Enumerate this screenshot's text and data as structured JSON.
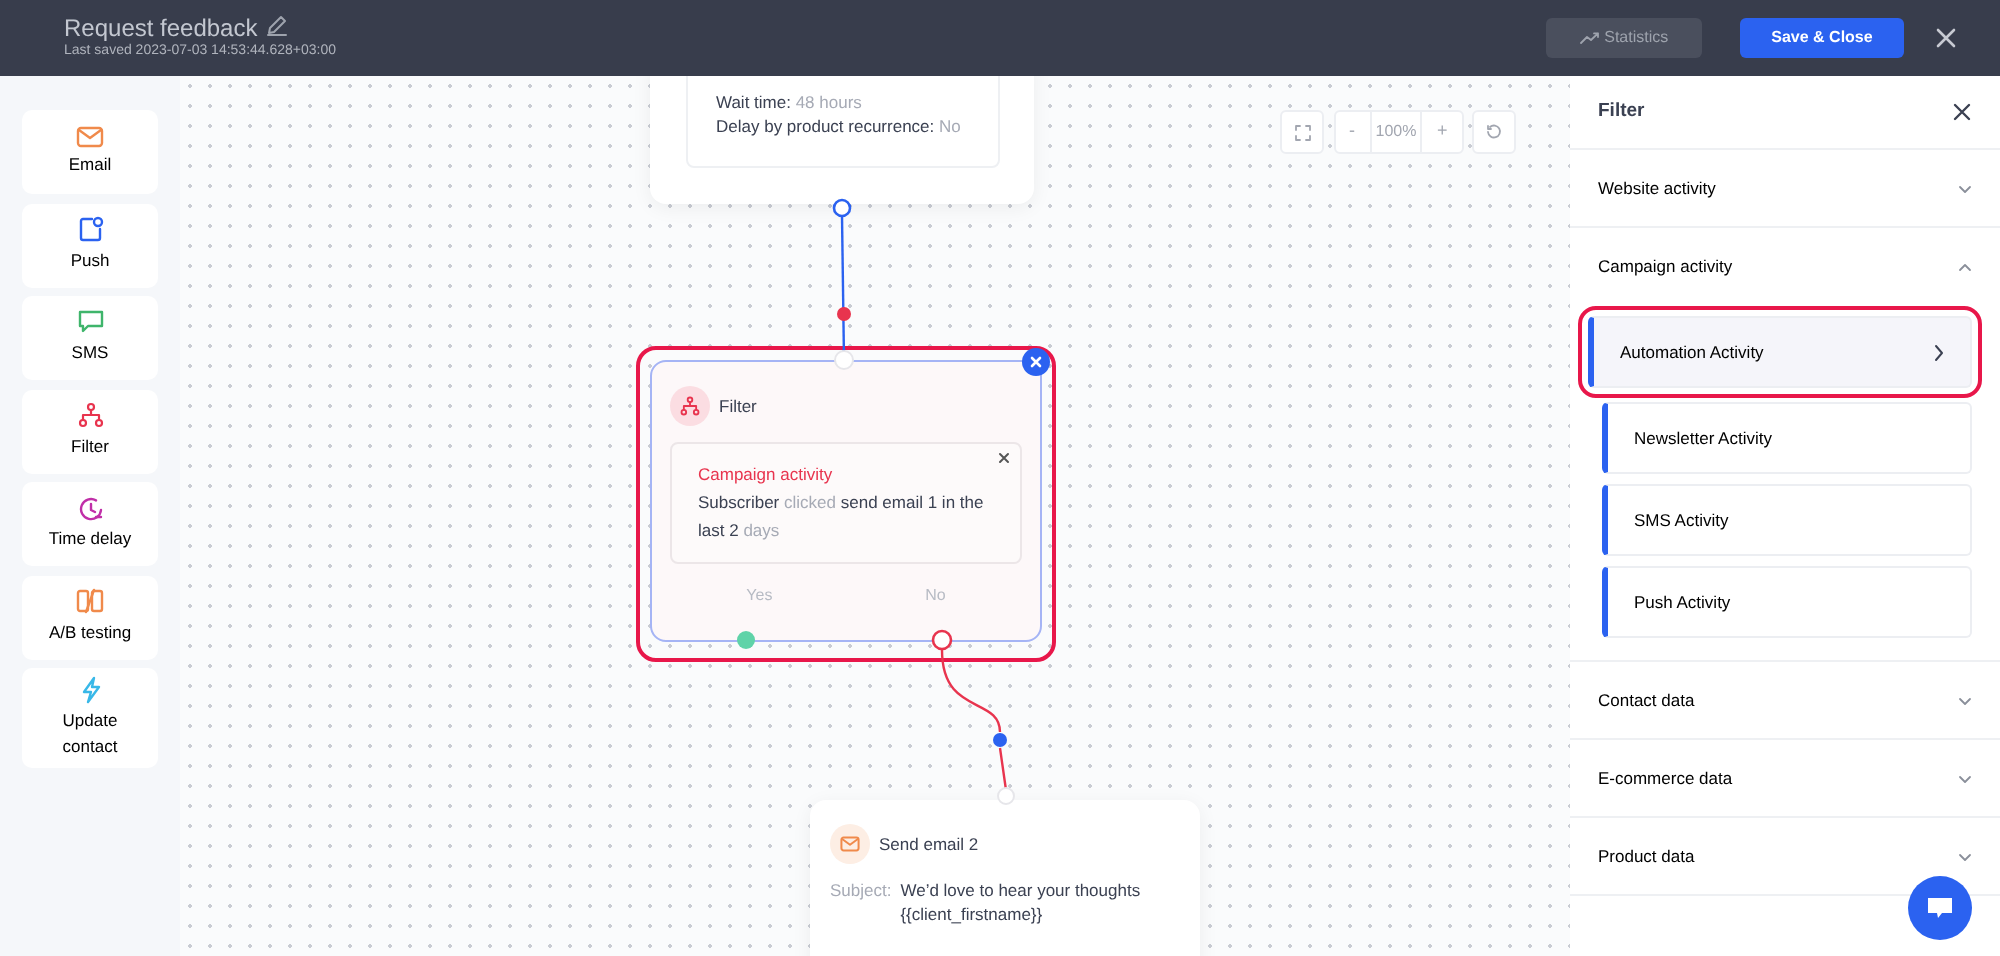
{
  "header": {
    "title": "Request feedback",
    "last_saved": "Last saved 2023-07-03 14:53:44.628+03:00",
    "buttons": [
      {
        "label": "Statistics",
        "kind": "secondary"
      },
      {
        "label": "Save & Close",
        "kind": "primary"
      }
    ]
  },
  "palette": [
    {
      "label": "Email",
      "kind": "email"
    },
    {
      "label": "Push",
      "kind": "push"
    },
    {
      "label": "SMS",
      "kind": "sms"
    },
    {
      "label": "Filter",
      "kind": "filter"
    },
    {
      "label": "Time delay",
      "kind": "delay"
    },
    {
      "label": "A/B testing",
      "kind": "ab"
    },
    {
      "label": "Update contact",
      "kind": "update"
    }
  ],
  "zoom": {
    "value": "100%",
    "minus": "-",
    "plus": "+"
  },
  "nodes": [
    {
      "kind": "delay",
      "fields": [
        {
          "label": "Wait time:",
          "value": "48 hours"
        },
        {
          "label": "Delay by product recurrence:",
          "value": "No"
        }
      ]
    },
    {
      "kind": "filter",
      "title": "Filter",
      "highlighted": true,
      "condition": {
        "title": "Campaign activity",
        "parts": [
          {
            "text": "Subscriber",
            "muted": false
          },
          {
            "text": "clicked",
            "muted": true
          },
          {
            "text": "send email 1 in the last 2",
            "muted": false
          },
          {
            "text": "days",
            "muted": true
          }
        ]
      },
      "branches": [
        {
          "label": "Yes",
          "connected": false,
          "color": "#5fd3a8"
        },
        {
          "label": "No",
          "connected": true,
          "color": "#e8344e"
        }
      ]
    },
    {
      "kind": "email",
      "title": "Send email 2",
      "fields": [
        {
          "label": "Subject:",
          "value": "We’d love to hear your thoughts {{client_firstname}}"
        }
      ]
    }
  ],
  "filter_panel": {
    "title": "Filter",
    "sections": [
      {
        "label": "Website activity",
        "expanded": false
      },
      {
        "label": "Campaign activity",
        "expanded": true,
        "items": [
          {
            "label": "Automation Activity",
            "highlighted": true
          },
          {
            "label": "Newsletter Activity",
            "highlighted": false
          },
          {
            "label": "SMS Activity",
            "highlighted": false
          },
          {
            "label": "Push Activity",
            "highlighted": false
          }
        ]
      },
      {
        "label": "Contact data",
        "expanded": false
      },
      {
        "label": "E-commerce data",
        "expanded": false
      },
      {
        "label": "Product data",
        "expanded": false
      }
    ]
  }
}
